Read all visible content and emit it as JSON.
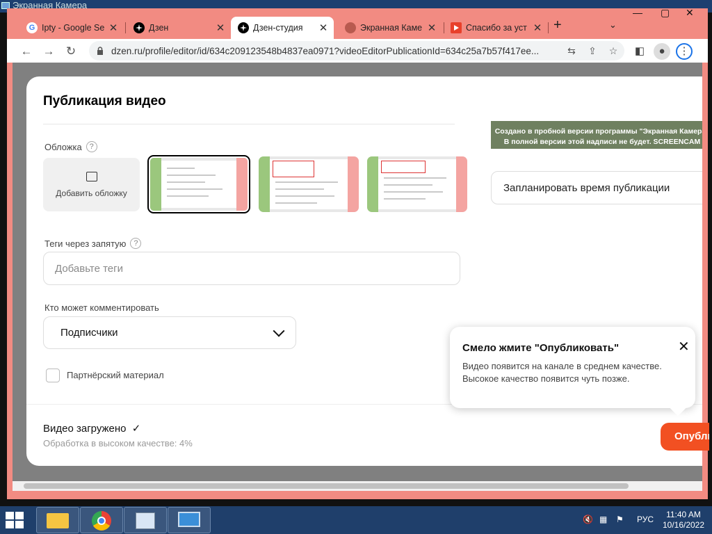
{
  "outer": {
    "title": "Экранная Камера"
  },
  "tabs": [
    {
      "label": "Ipty - Google Se",
      "icon": "google-icon"
    },
    {
      "label": "Дзен",
      "icon": "dzen-icon"
    },
    {
      "label": "Дзен-студия",
      "icon": "dzen-icon",
      "active": true
    },
    {
      "label": "Экранная Каме",
      "icon": "site-icon"
    },
    {
      "label": "Спасибо за уст",
      "icon": "video-icon"
    }
  ],
  "browser": {
    "url": "dzen.ru/profile/editor/id/634c209123548b4837ea0971?videoEditorPublicationId=634c25a7b57f417ee..."
  },
  "modal": {
    "title": "Публикация видео",
    "cover_label": "Обложка",
    "add_cover": "Добавить обложку",
    "tags_label": "Теги через запятую",
    "tags_placeholder": "Добавьте теги",
    "comments_label": "Кто может комментировать",
    "comments_value": "Подписчики",
    "partner_label": "Партнёрский материал",
    "uploaded": "Видео загружено",
    "processing": "Обработка в высоком качестве: 4%",
    "schedule": "Запланировать время публикации",
    "publish": "Опубликовать"
  },
  "preview": {
    "line1": "Создано в пробной версии программы \"Экранная Камера\"",
    "line2": "В полной версии этой надписи не будет. SCREENCAM"
  },
  "tooltip": {
    "title": "Смело жмите \"Опубликовать\"",
    "body": "Видео появится на канале в среднем качестве. Высокое качество появится чуть позже."
  },
  "taskbar": {
    "time": "11:40 AM",
    "date": "10/16/2022",
    "lang": "РУС"
  },
  "colors": {
    "accent": "#f25022",
    "tab_bar": "#f28b82",
    "taskbar": "#1f3f6b"
  }
}
